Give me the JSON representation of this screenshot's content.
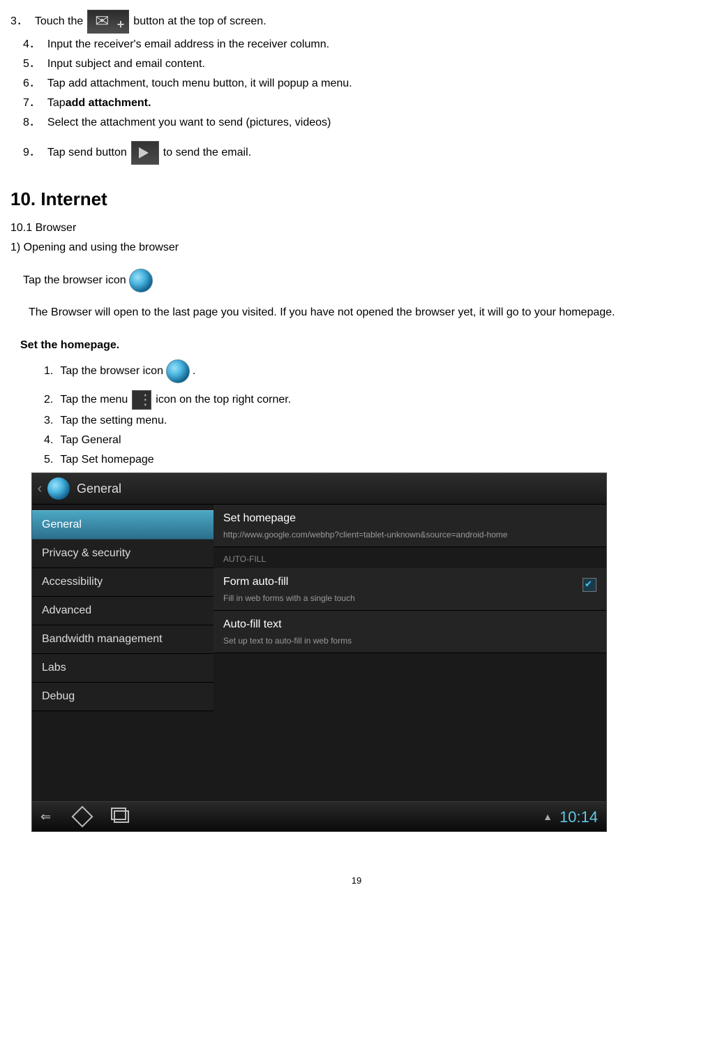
{
  "steps_a": [
    {
      "num": "3．",
      "pre": "Touch the",
      "post": " button at the top of screen.",
      "icon": "compose"
    },
    {
      "num": "4．",
      "text": "Input the receiver's email address in the receiver column."
    },
    {
      "num": "5．",
      "text": "Input subject and email content."
    },
    {
      "num": "6．",
      "text": "Tap add attachment, touch menu button, it will popup a menu."
    },
    {
      "num": "7．",
      "text_pre": " Tap ",
      "bold": "add attachment."
    },
    {
      "num": "8．",
      "text": " Select the attachment you want to send (pictures, videos)"
    },
    {
      "num": "9．",
      "pre": " Tap send button",
      "post": " to send the email.",
      "icon": "send"
    }
  ],
  "section_head": "10. Internet",
  "subhead": "10.1 Browser",
  "line_open": "1)    Opening and using the browser",
  "tap_browser": "Tap the browser icon",
  "browser_open_text": "The Browser will open to the last page you visited. If you have not opened the browser yet, it will go to your homepage.",
  "set_homepage": "Set the homepage.",
  "steps_b": [
    {
      "num": "1.",
      "pre": "Tap the browser icon ",
      "icon": "browser",
      "post": "."
    },
    {
      "num": "2.",
      "pre": "Tap the menu",
      "icon": "menu",
      "post": " icon on the top right corner."
    },
    {
      "num": "3.",
      "text": "Tap the setting menu."
    },
    {
      "num": "4.",
      "text": "Tap General"
    },
    {
      "num": "5.",
      "text": " Tap Set homepage"
    }
  ],
  "android": {
    "header_title": "General",
    "sidebar": [
      "General",
      "Privacy & security",
      "Accessibility",
      "Advanced",
      "Bandwidth management",
      "Labs",
      "Debug"
    ],
    "homepage_title": "Set homepage",
    "homepage_sub": "http://www.google.com/webhp?client=tablet-unknown&source=android-home",
    "autofill_label": "AUTO-FILL",
    "formfill_title": "Form auto-fill",
    "formfill_sub": "Fill in web forms with a single touch",
    "autofilltext_title": "Auto-fill text",
    "autofilltext_sub": "Set up text to auto-fill in web forms",
    "clock": "10:14"
  },
  "page_number": "19"
}
